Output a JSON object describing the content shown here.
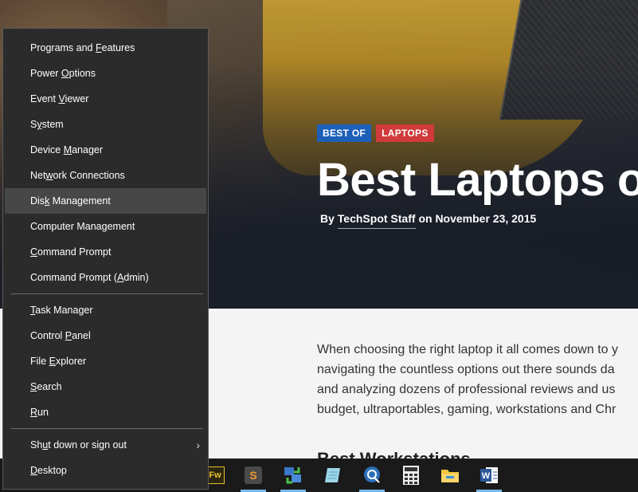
{
  "article": {
    "tags": [
      "BEST OF",
      "LAPTOPS"
    ],
    "title": "Best Laptops of",
    "byline_prefix": "By",
    "author": "TechSpot Staff",
    "byline_on": "on",
    "date": "November 23, 2015",
    "body_lines": [
      "When choosing the right laptop it all comes down to y",
      "navigating the countless options out there sounds da",
      "and analyzing dozens of professional reviews and us",
      "budget, ultraportables, gaming, workstations and Chr"
    ],
    "subhead": "Best Workstations"
  },
  "menu": {
    "items": [
      {
        "pre": "Programs and ",
        "u": "F",
        "post": "eatures"
      },
      {
        "pre": "Power ",
        "u": "O",
        "post": "ptions"
      },
      {
        "pre": "Event ",
        "u": "V",
        "post": "iewer"
      },
      {
        "pre": "S",
        "u": "y",
        "post": "stem"
      },
      {
        "pre": "Device ",
        "u": "M",
        "post": "anager"
      },
      {
        "pre": "Net",
        "u": "w",
        "post": "ork Connections"
      },
      {
        "pre": "Dis",
        "u": "k",
        "post": " Management"
      },
      {
        "pre": "Computer Mana",
        "u": "g",
        "post": "ement"
      },
      {
        "pre": "",
        "u": "C",
        "post": "ommand Prompt"
      },
      {
        "pre": "Command Prompt (",
        "u": "A",
        "post": "dmin)"
      },
      {
        "pre": "",
        "u": "T",
        "post": "ask Manager"
      },
      {
        "pre": "Control ",
        "u": "P",
        "post": "anel"
      },
      {
        "pre": "File ",
        "u": "E",
        "post": "xplorer"
      },
      {
        "pre": "",
        "u": "S",
        "post": "earch"
      },
      {
        "pre": "",
        "u": "R",
        "post": "un"
      },
      {
        "pre": "Sh",
        "u": "u",
        "post": "t down or sign out"
      },
      {
        "pre": "",
        "u": "D",
        "post": "esktop"
      }
    ],
    "highlighted_index": 6,
    "submenu_chevron": "›"
  },
  "taskbar": {
    "icons": [
      "fireworks-icon",
      "sublime-text-icon",
      "network-transfer-icon",
      "notepad-icon",
      "chat-app-icon",
      "calculator-icon",
      "file-explorer-icon",
      "word-icon"
    ],
    "fireworks_label": "Fw",
    "sublime_label": "S"
  }
}
